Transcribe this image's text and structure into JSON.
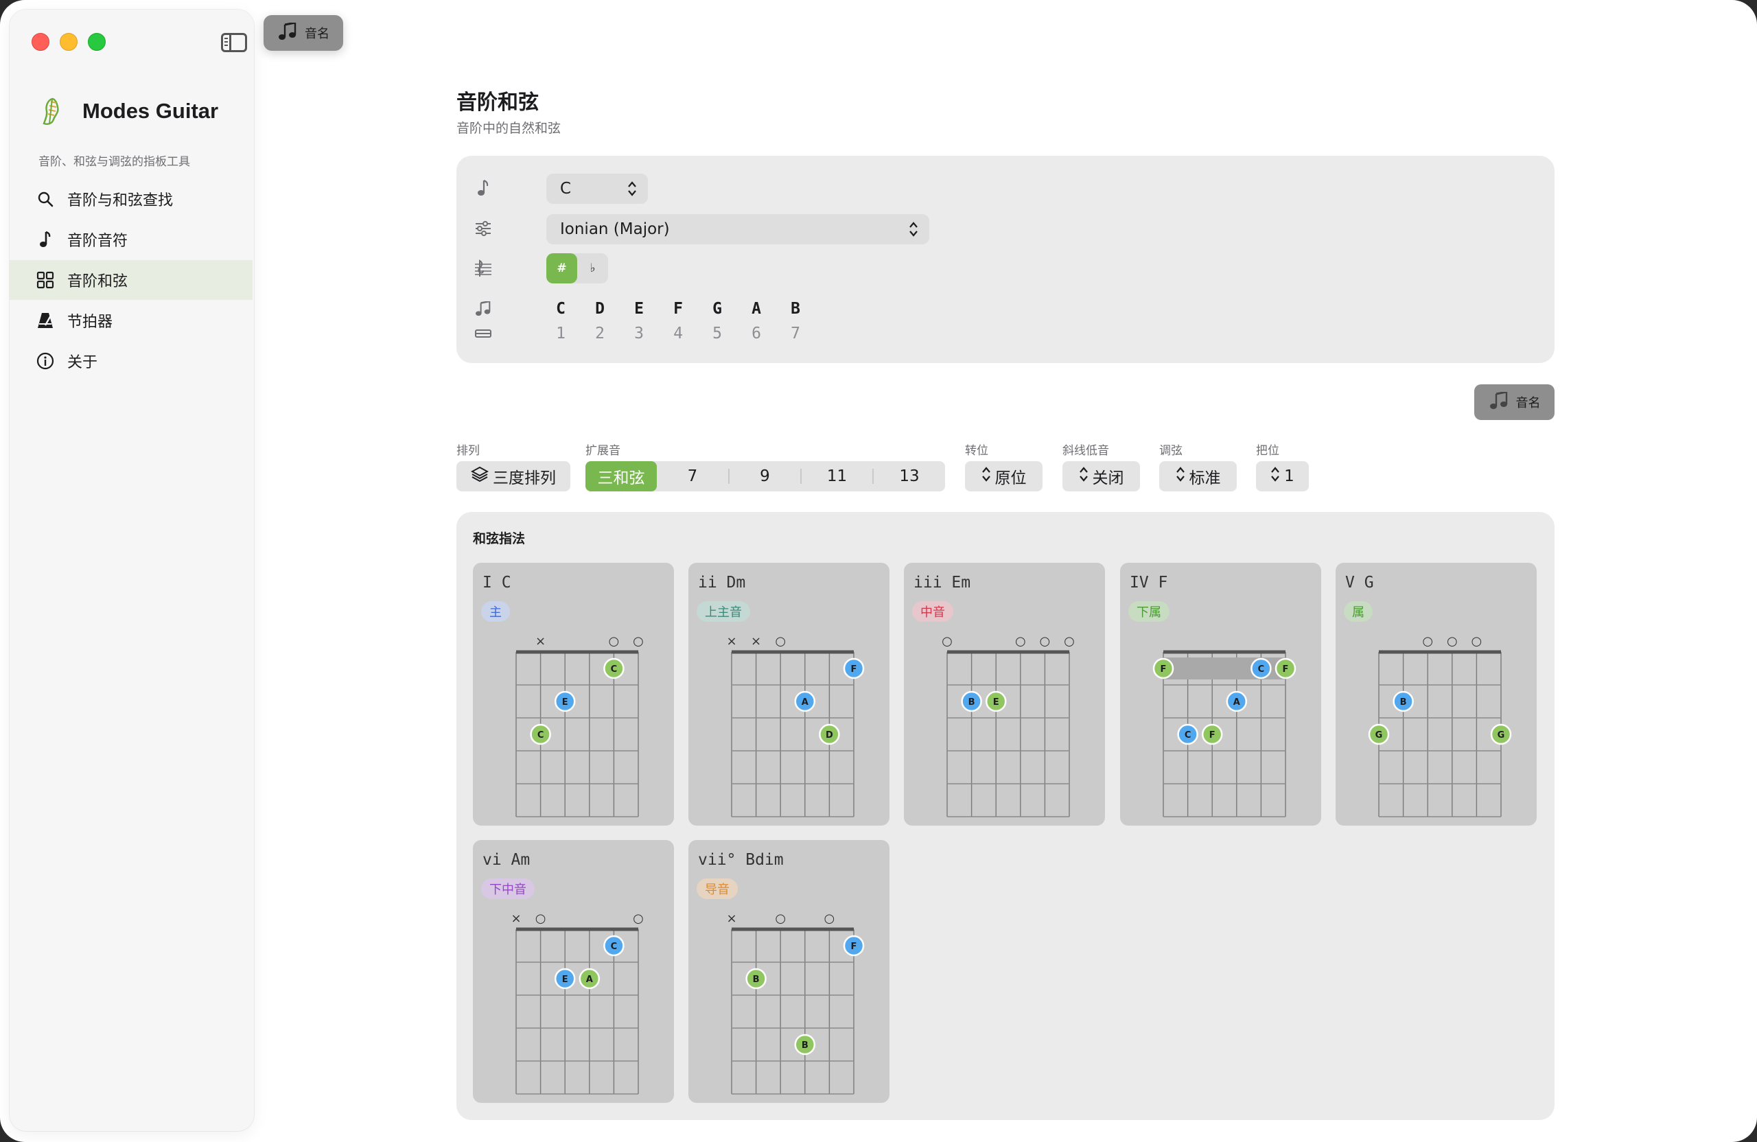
{
  "sidebar": {
    "app_title": "Modes Guitar",
    "app_subtitle": "音阶、和弦与调弦的指板工具",
    "items": [
      {
        "label": "音阶与和弦查找",
        "icon": "search-icon"
      },
      {
        "label": "音阶音符",
        "icon": "music-note-icon"
      },
      {
        "label": "音阶和弦",
        "icon": "grid-icon",
        "active": true
      },
      {
        "label": "节拍器",
        "icon": "metronome-icon"
      },
      {
        "label": "关于",
        "icon": "info-icon"
      }
    ]
  },
  "toolbar": {
    "notes_label": "音名"
  },
  "main": {
    "title": "音阶和弦",
    "subtitle": "音阶中的自然和弦",
    "root_value": "C",
    "mode_value": "Ionian (Major)",
    "accidentals": [
      "#",
      "♭"
    ],
    "accidental_selected": "#",
    "scale_notes": [
      "C",
      "D",
      "E",
      "F",
      "G",
      "A",
      "B"
    ],
    "scale_degrees": [
      "1",
      "2",
      "3",
      "4",
      "5",
      "6",
      "7"
    ],
    "notes_button_label": "音名"
  },
  "controls": {
    "arrangement": {
      "label": "排列",
      "value": "三度排列"
    },
    "extensions": {
      "label": "扩展音",
      "options": [
        "三和弦",
        "7",
        "9",
        "11",
        "13"
      ],
      "selected": "三和弦"
    },
    "inversion": {
      "label": "转位",
      "value": "原位"
    },
    "slash_bass": {
      "label": "斜线低音",
      "value": "关闭"
    },
    "tuning": {
      "label": "调弦",
      "value": "标准"
    },
    "position": {
      "label": "把位",
      "value": "1"
    }
  },
  "colors": {
    "accent_green": "#79b74f",
    "root_dot": "#8fc65f",
    "third_dot": "#52a8ef"
  },
  "chord_panel": {
    "title": "和弦指法",
    "chords": [
      {
        "name": "I C",
        "badge": "主",
        "badge_bg": "#c9d3ea",
        "badge_fg": "#3c6ad8",
        "strings": [
          "",
          "x",
          "",
          "",
          "o",
          "",
          "o"
        ],
        "markers": [
          "",
          "x",
          "",
          "",
          "o",
          "o"
        ],
        "dots": [
          {
            "s": 4,
            "f": 1,
            "n": "C",
            "c": "g"
          },
          {
            "s": 2,
            "f": 2,
            "n": "E",
            "c": "b"
          },
          {
            "s": 1,
            "f": 3,
            "n": "C",
            "c": "g"
          }
        ],
        "barre": null
      },
      {
        "name": "ii Dm",
        "badge": "上主音",
        "badge_bg": "#c4d8d4",
        "badge_fg": "#3a8a7a",
        "markers": [
          "x",
          "x",
          "o",
          "",
          "",
          ""
        ],
        "dots": [
          {
            "s": 5,
            "f": 1,
            "n": "F",
            "c": "b"
          },
          {
            "s": 3,
            "f": 2,
            "n": "A",
            "c": "b"
          },
          {
            "s": 4,
            "f": 3,
            "n": "D",
            "c": "g"
          }
        ],
        "barre": null
      },
      {
        "name": "iii Em",
        "badge": "中音",
        "badge_bg": "#e8c7cc",
        "badge_fg": "#d6344a",
        "markers": [
          "o",
          "",
          "",
          "o",
          "o",
          "o"
        ],
        "dots": [
          {
            "s": 1,
            "f": 2,
            "n": "B",
            "c": "b"
          },
          {
            "s": 2,
            "f": 2,
            "n": "E",
            "c": "g"
          }
        ],
        "barre": null
      },
      {
        "name": "IV F",
        "badge": "下属",
        "badge_bg": "#c7dcc0",
        "badge_fg": "#4c9a35",
        "markers": [
          "",
          "",
          "",
          "",
          "",
          ""
        ],
        "dots": [
          {
            "s": 0,
            "f": 1,
            "n": "F",
            "c": "g"
          },
          {
            "s": 4,
            "f": 1,
            "n": "C",
            "c": "b"
          },
          {
            "s": 5,
            "f": 1,
            "n": "F",
            "c": "g"
          },
          {
            "s": 3,
            "f": 2,
            "n": "A",
            "c": "b"
          },
          {
            "s": 1,
            "f": 3,
            "n": "C",
            "c": "b"
          },
          {
            "s": 2,
            "f": 3,
            "n": "F",
            "c": "g"
          }
        ],
        "barre": {
          "f": 1,
          "from": 0,
          "to": 5
        }
      },
      {
        "name": "V G",
        "badge": "属",
        "badge_bg": "#c7dcc0",
        "badge_fg": "#4c9a35",
        "markers": [
          "",
          "",
          "o",
          "o",
          "o",
          ""
        ],
        "dots": [
          {
            "s": 1,
            "f": 2,
            "n": "B",
            "c": "b"
          },
          {
            "s": 0,
            "f": 3,
            "n": "G",
            "c": "g"
          },
          {
            "s": 5,
            "f": 3,
            "n": "G",
            "c": "g"
          }
        ],
        "barre": null
      },
      {
        "name": "vi Am",
        "badge": "下中音",
        "badge_bg": "#d8c8e4",
        "badge_fg": "#9646c4",
        "markers": [
          "x",
          "o",
          "",
          "",
          "",
          "o"
        ],
        "dots": [
          {
            "s": 4,
            "f": 1,
            "n": "C",
            "c": "b"
          },
          {
            "s": 2,
            "f": 2,
            "n": "E",
            "c": "b"
          },
          {
            "s": 3,
            "f": 2,
            "n": "A",
            "c": "g"
          }
        ],
        "barre": null
      },
      {
        "name": "vii° Bdim",
        "badge": "导音",
        "badge_bg": "#e6d4c0",
        "badge_fg": "#e08a2a",
        "markers": [
          "x",
          "",
          "o",
          "",
          "o",
          ""
        ],
        "dots": [
          {
            "s": 5,
            "f": 1,
            "n": "F",
            "c": "b"
          },
          {
            "s": 1,
            "f": 2,
            "n": "B",
            "c": "g"
          },
          {
            "s": 3,
            "f": 4,
            "n": "B",
            "c": "g"
          }
        ],
        "barre": null
      }
    ]
  }
}
